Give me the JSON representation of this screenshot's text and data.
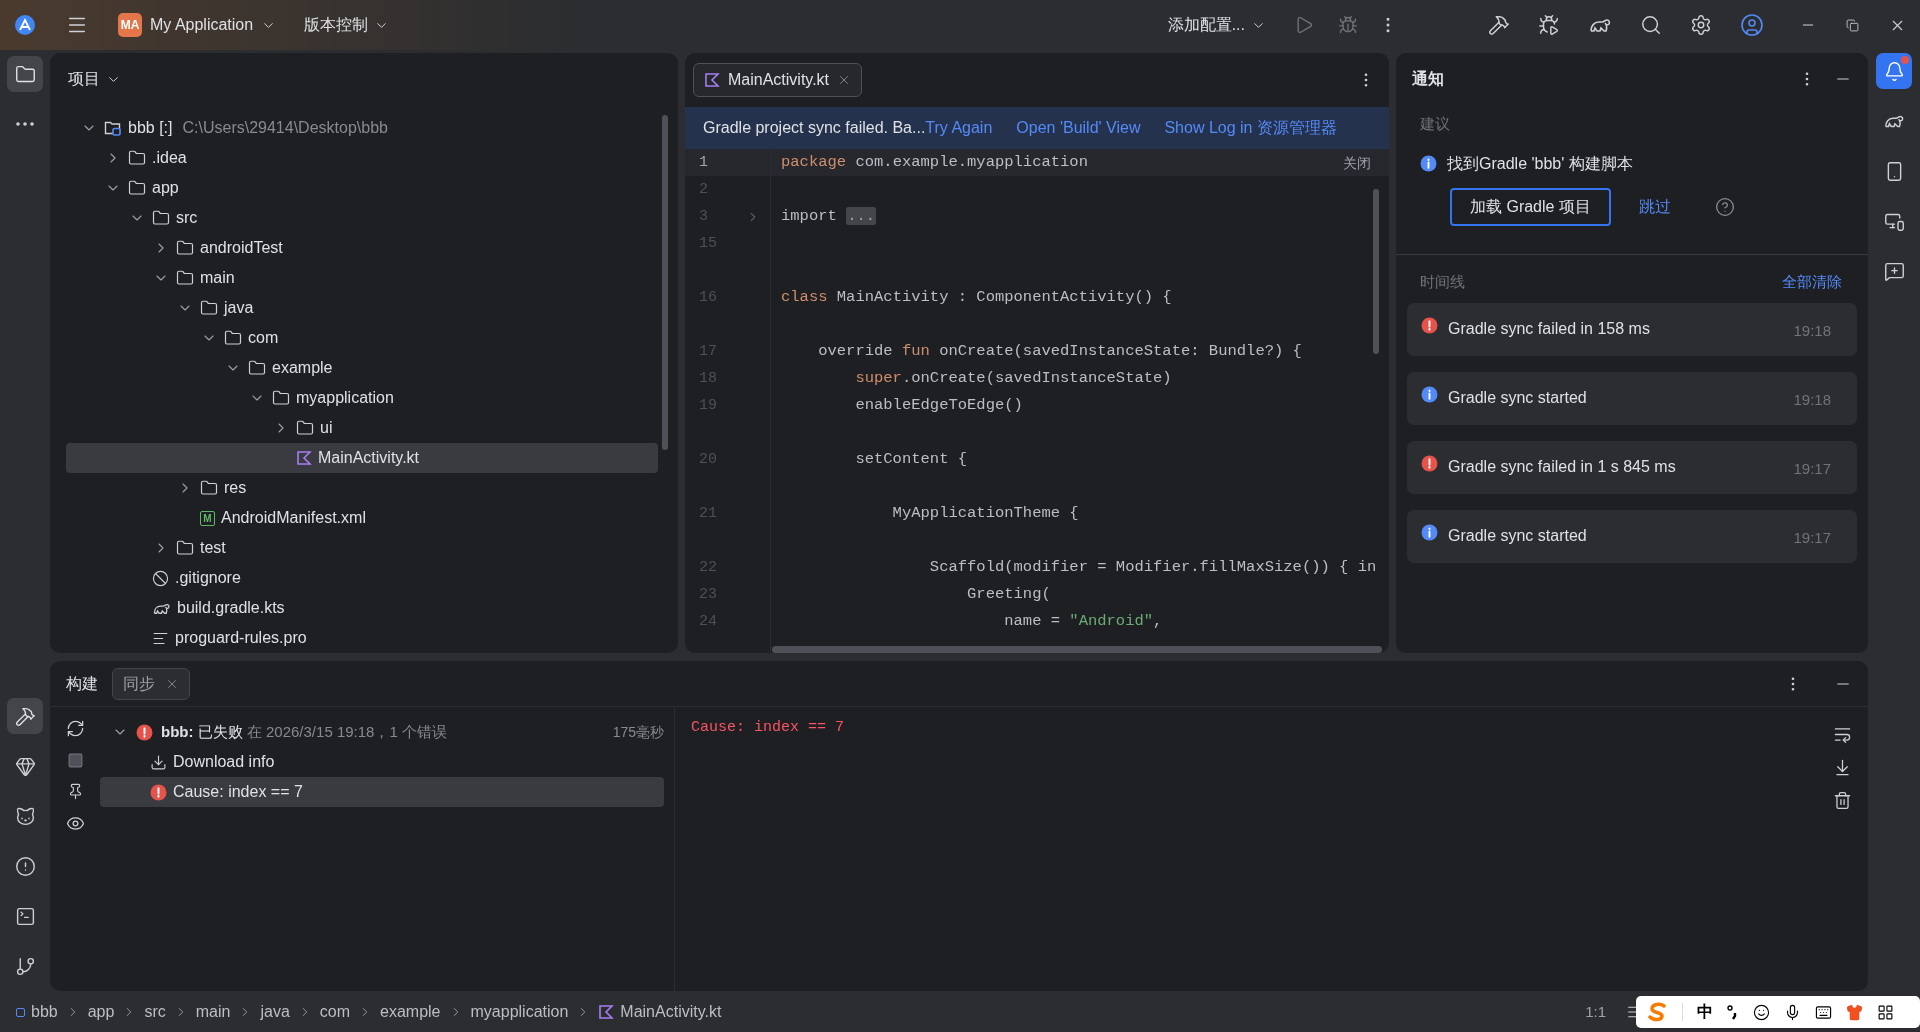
{
  "title_bar": {
    "project_badge": "MA",
    "project": "My Application",
    "vcs": "版本控制",
    "run_config": "添加配置...",
    "run_enabled": false
  },
  "left_toolbar_top": [
    {
      "kind": "folder",
      "selected": true
    },
    {
      "kind": "more",
      "selected": false
    }
  ],
  "left_toolbar_bottom": [
    {
      "kind": "hammer",
      "selected": true
    },
    {
      "kind": "gem",
      "selected": false
    },
    {
      "kind": "cat",
      "selected": false
    },
    {
      "kind": "alert",
      "selected": false
    },
    {
      "kind": "terminal",
      "selected": false
    },
    {
      "kind": "branch",
      "selected": false
    }
  ],
  "project_panel": {
    "title": "项目",
    "tree": [
      {
        "label": "bbb [:]",
        "path": "C:\\Users\\29414\\Desktop\\bbb",
        "kind": "module",
        "expanded": true,
        "selected": false,
        "children": [
          {
            "label": ".idea",
            "kind": "folder",
            "expanded": false,
            "selected": false
          },
          {
            "label": "app",
            "kind": "folder",
            "expanded": true,
            "selected": false,
            "children": [
              {
                "label": "src",
                "kind": "folder",
                "expanded": true,
                "selected": false,
                "children": [
                  {
                    "label": "androidTest",
                    "kind": "folder",
                    "expanded": false,
                    "selected": false
                  },
                  {
                    "label": "main",
                    "kind": "folder",
                    "expanded": true,
                    "selected": false,
                    "children": [
                      {
                        "label": "java",
                        "kind": "folder",
                        "expanded": true,
                        "selected": false,
                        "children": [
                          {
                            "label": "com",
                            "kind": "folder",
                            "expanded": true,
                            "selected": false,
                            "children": [
                              {
                                "label": "example",
                                "kind": "folder",
                                "expanded": true,
                                "selected": false,
                                "children": [
                                  {
                                    "label": "myapplication",
                                    "kind": "folder",
                                    "expanded": true,
                                    "selected": false,
                                    "children": [
                                      {
                                        "label": "ui",
                                        "kind": "folder",
                                        "expanded": false,
                                        "selected": false
                                      },
                                      {
                                        "label": "MainActivity.kt",
                                        "kind": "kotlin",
                                        "selected": true
                                      }
                                    ]
                                  }
                                ]
                              }
                            ]
                          }
                        ]
                      },
                      {
                        "label": "res",
                        "kind": "folder",
                        "expanded": false,
                        "selected": false
                      },
                      {
                        "label": "AndroidManifest.xml",
                        "kind": "manifest",
                        "badge": "M",
                        "selected": false
                      }
                    ]
                  },
                  {
                    "label": "test",
                    "kind": "folder",
                    "expanded": false,
                    "selected": false
                  }
                ]
              },
              {
                "label": ".gitignore",
                "kind": "ignore",
                "selected": false
              },
              {
                "label": "build.gradle.kts",
                "kind": "gradle",
                "selected": false
              },
              {
                "label": "proguard-rules.pro",
                "kind": "text",
                "selected": false
              }
            ]
          }
        ]
      }
    ]
  },
  "editor": {
    "tabs": [
      {
        "label": "MainActivity.kt",
        "selected": true
      }
    ],
    "banner": {
      "message": "Gradle project sync failed. Ba...",
      "links": [
        "Try Again",
        "Open 'Build' View",
        "Show Log in 资源管理器"
      ]
    },
    "close_hint": "关闭",
    "lines": [
      {
        "number": "1",
        "current": true,
        "gap_above": false,
        "tokens": [
          {
            "kind": "keyword",
            "text": "package"
          },
          {
            "kind": "plain",
            "text": " com.example.myapplication"
          }
        ]
      },
      {
        "number": "2",
        "current": false,
        "gap_above": false
      },
      {
        "number": "3",
        "current": false,
        "gap_above": false,
        "foldable": true,
        "tokens": [
          {
            "kind": "plain",
            "text": "import "
          },
          {
            "kind": "fold",
            "text": "..."
          }
        ]
      },
      {
        "number": "15",
        "current": false,
        "gap_above": false
      },
      {
        "number": "16",
        "current": false,
        "gap_above": true,
        "tokens": [
          {
            "kind": "keyword",
            "text": "class"
          },
          {
            "kind": "plain",
            "text": " MainActivity : ComponentActivity() {"
          }
        ]
      },
      {
        "number": "17",
        "current": false,
        "gap_above": true,
        "tokens": [
          {
            "kind": "plain",
            "text": "    override "
          },
          {
            "kind": "keyword",
            "text": "fun"
          },
          {
            "kind": "plain",
            "text": " onCreate(savedInstanceState: Bundle?) {"
          }
        ]
      },
      {
        "number": "18",
        "current": false,
        "gap_above": false,
        "tokens": [
          {
            "kind": "keyword",
            "text": "        super"
          },
          {
            "kind": "plain",
            "text": ".onCreate(savedInstanceState)"
          }
        ]
      },
      {
        "number": "19",
        "current": false,
        "gap_above": false,
        "tokens": [
          {
            "kind": "plain",
            "text": "        enableEdgeToEdge()"
          }
        ]
      },
      {
        "number": "20",
        "current": false,
        "gap_above": true,
        "tokens": [
          {
            "kind": "plain",
            "text": "        setContent {"
          }
        ]
      },
      {
        "number": "21",
        "current": false,
        "gap_above": true,
        "tokens": [
          {
            "kind": "plain",
            "text": "            MyApplicationTheme {"
          }
        ]
      },
      {
        "number": "22",
        "current": false,
        "gap_above": true,
        "tokens": [
          {
            "kind": "plain",
            "text": "                Scaffold(modifier = Modifier.fillMaxSize()) { in"
          }
        ]
      },
      {
        "number": "23",
        "current": false,
        "gap_above": false,
        "tokens": [
          {
            "kind": "plain",
            "text": "                    Greeting("
          }
        ]
      },
      {
        "number": "24",
        "current": false,
        "gap_above": false,
        "tokens": [
          {
            "kind": "plain",
            "text": "                        name = "
          },
          {
            "kind": "string",
            "text": "\"Android\""
          },
          {
            "kind": "plain",
            "text": ","
          }
        ]
      }
    ]
  },
  "notifications": {
    "title": "通知",
    "suggestions_label": "建议",
    "suggestion": {
      "kind": "info",
      "text": "找到Gradle 'bbb' 构建脚本",
      "primary": "加载 Gradle 项目",
      "secondary": "跳过"
    },
    "timeline_label": "时间线",
    "clear_all": "全部清除",
    "items": [
      {
        "kind": "error",
        "text": "Gradle sync failed in 158 ms",
        "time": "19:18"
      },
      {
        "kind": "info",
        "text": "Gradle sync started",
        "time": "19:18"
      },
      {
        "kind": "error",
        "text": "Gradle sync failed in 1 s 845 ms",
        "time": "19:17"
      },
      {
        "kind": "info",
        "text": "Gradle sync started",
        "time": "19:17"
      }
    ]
  },
  "right_toolbar": [
    {
      "kind": "bell",
      "selected": true,
      "badge": true
    },
    {
      "kind": "gradle",
      "selected": false
    },
    {
      "kind": "device",
      "selected": false
    },
    {
      "kind": "mirror",
      "selected": false
    },
    {
      "kind": "chat",
      "selected": false
    }
  ],
  "build_panel": {
    "title": "构建",
    "tabs": [
      {
        "label": "同步",
        "selected": true
      }
    ],
    "tree": {
      "name": "bbb:",
      "status": "已失败",
      "detail": "在 2026/3/15 19:18，1 个错误",
      "duration": "175毫秒",
      "kind": "error",
      "expanded": true,
      "children": [
        {
          "kind": "download",
          "label": "Download info",
          "selected": false
        },
        {
          "kind": "error",
          "label": "Cause: index == 7",
          "selected": true
        }
      ]
    },
    "console": "Cause: index == 7"
  },
  "status_bar": {
    "breadcrumbs": [
      {
        "kind": "module",
        "label": "bbb"
      },
      {
        "kind": "folder",
        "label": "app"
      },
      {
        "kind": "folder",
        "label": "src"
      },
      {
        "kind": "folder",
        "label": "main"
      },
      {
        "kind": "folder",
        "label": "java"
      },
      {
        "kind": "folder",
        "label": "com"
      },
      {
        "kind": "folder",
        "label": "example"
      },
      {
        "kind": "folder",
        "label": "myapplication"
      },
      {
        "kind": "kotlin",
        "label": "MainActivity.kt"
      }
    ],
    "position": "1:1",
    "ime_mode": "中"
  }
}
